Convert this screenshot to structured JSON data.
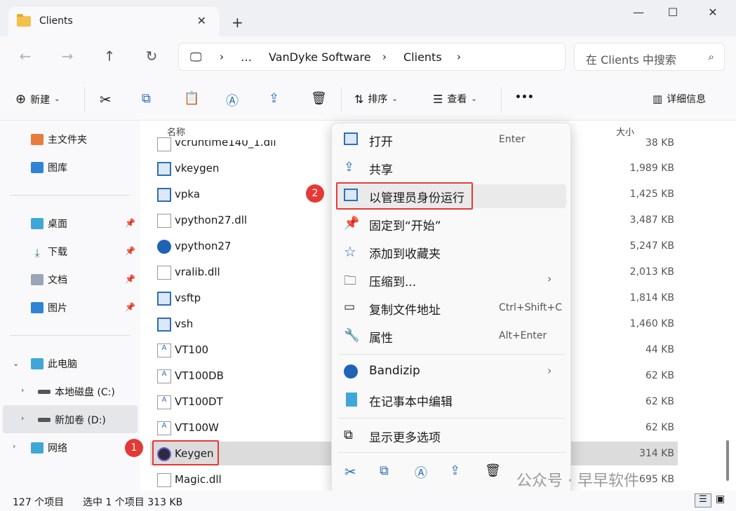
{
  "tab": {
    "title": "Clients"
  },
  "nav": {
    "breadcrumb": [
      "…",
      "VanDyke Software",
      "Clients"
    ],
    "search_placeholder": "在 Clients 中搜索"
  },
  "toolbar": {
    "new_label": "新建",
    "sort_label": "排序",
    "view_label": "查看",
    "more_label": "•••",
    "details_label": "详细信息"
  },
  "sidebar": {
    "items": [
      {
        "label": "主文件夹",
        "icon": "home-icon"
      },
      {
        "label": "图库",
        "icon": "gallery-icon"
      },
      {
        "label": "桌面",
        "icon": "desktop-icon",
        "pinned": true
      },
      {
        "label": "下载",
        "icon": "download-icon",
        "pinned": true
      },
      {
        "label": "文档",
        "icon": "document-icon",
        "pinned": true
      },
      {
        "label": "图片",
        "icon": "pictures-icon",
        "pinned": true
      },
      {
        "label": "此电脑",
        "icon": "computer-icon"
      },
      {
        "label": "本地磁盘 (C:)",
        "icon": "drive-icon"
      },
      {
        "label": "新加卷 (D:)",
        "icon": "drive-icon",
        "selected": true
      },
      {
        "label": "网络",
        "icon": "network-icon"
      }
    ]
  },
  "filelist": {
    "headers": {
      "name": "名称",
      "size": "大小"
    },
    "rows": [
      {
        "name": "vcruntime140_1.dll",
        "size": "38 KB",
        "icon": "dll-icon"
      },
      {
        "name": "vkeygen",
        "size": "1,989 KB",
        "icon": "exe-icon"
      },
      {
        "name": "vpka",
        "size": "1,425 KB",
        "icon": "exe-icon"
      },
      {
        "name": "vpython27.dll",
        "size": "3,487 KB",
        "icon": "dll-icon"
      },
      {
        "name": "vpython27",
        "size": "5,247 KB",
        "icon": "zip-icon"
      },
      {
        "name": "vralib.dll",
        "size": "2,013 KB",
        "icon": "dll-icon"
      },
      {
        "name": "vsftp",
        "size": "1,814 KB",
        "icon": "exe-icon"
      },
      {
        "name": "vsh",
        "size": "1,460 KB",
        "icon": "exe-icon"
      },
      {
        "name": "VT100",
        "size": "44 KB",
        "icon": "font-icon"
      },
      {
        "name": "VT100DB",
        "size": "62 KB",
        "icon": "font-icon"
      },
      {
        "name": "VT100DT",
        "size": "62 KB",
        "icon": "font-icon"
      },
      {
        "name": "VT100W",
        "size": "62 KB",
        "icon": "font-icon"
      },
      {
        "name": "Keygen",
        "size": "314 KB",
        "icon": "keygen-icon",
        "selected": true
      },
      {
        "name": "Magic.dll",
        "size": "695 KB",
        "icon": "dll-icon"
      }
    ]
  },
  "context_menu": {
    "items": [
      {
        "label": "打开",
        "shortcut": "Enter"
      },
      {
        "label": "共享",
        "shortcut": ""
      },
      {
        "label": "以管理员身份运行",
        "shortcut": ""
      },
      {
        "label": "固定到“开始”",
        "shortcut": ""
      },
      {
        "label": "添加到收藏夹",
        "shortcut": ""
      },
      {
        "label": "压缩到...",
        "shortcut": ""
      },
      {
        "label": "复制文件地址",
        "shortcut": "Ctrl+Shift+C"
      },
      {
        "label": "属性",
        "shortcut": "Alt+Enter"
      },
      {
        "label": "Bandizip",
        "shortcut": ""
      },
      {
        "label": "在记事本中编辑",
        "shortcut": ""
      },
      {
        "label": "显示更多选项",
        "shortcut": ""
      }
    ]
  },
  "annotations": {
    "badge1": "1",
    "badge2": "2"
  },
  "status": {
    "count": "127 个项目",
    "selection": "选中 1 个项目  313 KB"
  },
  "watermark": "公众号 · 早早软件",
  "colors": {
    "accent": "#0067c0",
    "highlight": "#e53935",
    "selected_row": "#dcdcdc"
  }
}
